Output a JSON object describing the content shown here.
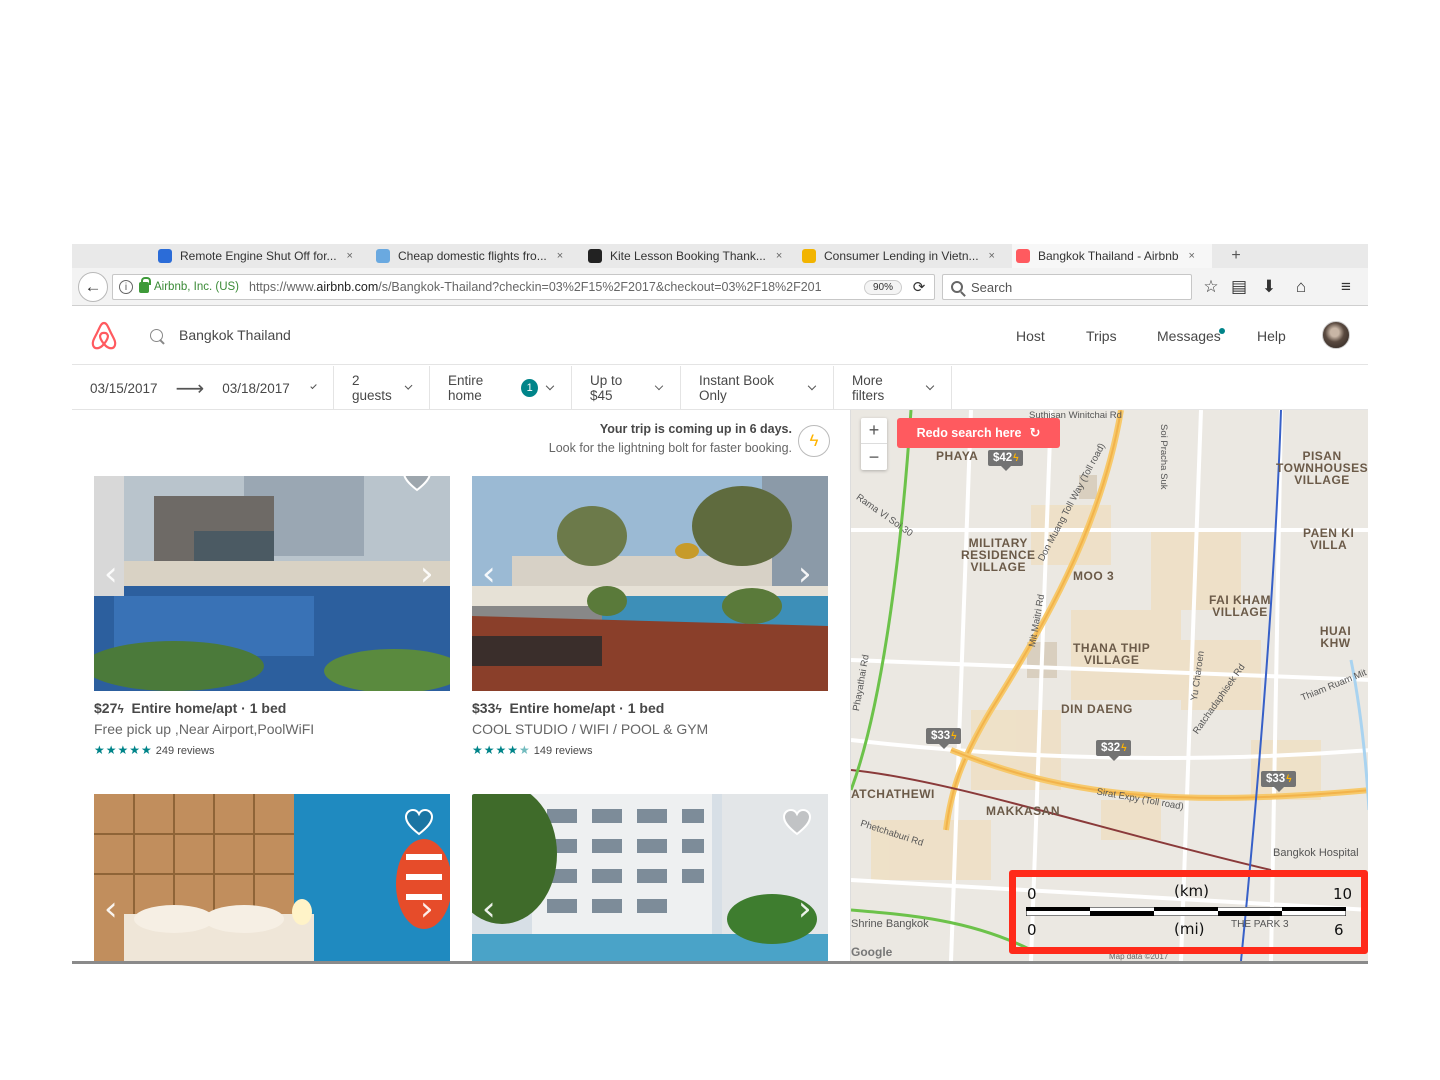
{
  "browser": {
    "tabs": [
      {
        "title": "Remote Engine Shut Off for...",
        "color": "#2b6cd8"
      },
      {
        "title": "Cheap domestic flights fro...",
        "color": "#6aa9e0"
      },
      {
        "title": "Kite Lesson Booking Thank...",
        "color": "#222222"
      },
      {
        "title": "Consumer Lending in Vietn...",
        "color": "#f2b400"
      },
      {
        "title": "Bangkok Thailand - Airbnb",
        "color": "#ff5a5f"
      }
    ],
    "tab_close": "×",
    "new_tab": "+",
    "site_identity": "Airbnb, Inc. (US)",
    "url_prefix": "https://www.",
    "url_host": "airbnb.com",
    "url_path": "/s/Bangkok-Thailand?checkin=03%2F15%2F2017&checkout=03%2F18%2F201",
    "zoom": "90%",
    "search_placeholder": "Search"
  },
  "header": {
    "search_value": "Bangkok Thailand",
    "nav": [
      "Host",
      "Trips",
      "Messages",
      "Help"
    ],
    "brand_color": "#ff5a5f"
  },
  "filters": {
    "checkin": "03/15/2017",
    "checkout": "03/18/2017",
    "guests": "2 guests",
    "room_type": "Entire home",
    "room_type_count": "1",
    "price": "Up to $45",
    "instant": "Instant Book Only",
    "more": "More filters"
  },
  "trip_notice": {
    "line1": "Your trip is coming up in 6 days.",
    "line2": "Look for the lightning bolt for faster booking."
  },
  "listings": [
    {
      "price": "$27",
      "title": "Entire home/apt · 1 bed",
      "subtitle": "Free pick up ,Near Airport,PoolWiFI",
      "rating": 5,
      "reviews": "249 reviews"
    },
    {
      "price": "$33",
      "title": "Entire home/apt · 1 bed",
      "subtitle": "COOL STUDIO / WIFI / POOL & GYM",
      "rating": 4.5,
      "reviews": "149 reviews"
    },
    {
      "price": "",
      "title": "",
      "subtitle": "",
      "rating": null,
      "reviews": ""
    },
    {
      "price": "",
      "title": "",
      "subtitle": "",
      "rating": null,
      "reviews": ""
    }
  ],
  "map": {
    "redo_label": "Redo search here",
    "zoom_in": "+",
    "zoom_out": "−",
    "pins": [
      "$42",
      "$33",
      "$32",
      "$33"
    ],
    "areas": [
      {
        "name": "MILITARY RESIDENCE VILLAGE",
        "lines": [
          "MILITARY",
          "RESIDENCE",
          "VILLAGE"
        ]
      },
      {
        "name": "MOO 3",
        "lines": [
          "MOO 3"
        ]
      },
      {
        "name": "THANA THIP VILLAGE",
        "lines": [
          "THANA THIP",
          "VILLAGE"
        ]
      },
      {
        "name": "DIN DAENG",
        "lines": [
          "DIN DAENG"
        ]
      },
      {
        "name": "FAI KHAM VILLAGE",
        "lines": [
          "FAI KHAM",
          "VILLAGE"
        ]
      },
      {
        "name": "PISAN TOWNHOUSES VILLAGE",
        "lines": [
          "PISAN",
          "TOWNHOUSES",
          "VILLAGE"
        ]
      },
      {
        "name": "PAEN KI VILLA",
        "lines": [
          "PAEN KI",
          "VILLA"
        ]
      },
      {
        "name": "HUAI KHW",
        "lines": [
          "HUAI KHW"
        ]
      },
      {
        "name": "MAKKASAN",
        "lines": [
          "MAKKASAN"
        ]
      },
      {
        "name": "ATCHATHEWI",
        "lines": [
          "ATCHATHEWI"
        ]
      },
      {
        "name": "PHAYA",
        "lines": [
          "PHAYA"
        ]
      }
    ],
    "roads": [
      "Don Muang Toll Way (Toll road)",
      "Sirat Expy (Toll road)",
      "Phetchaburi Rd",
      "Phayathai Rd",
      "Mit Maitri Rd",
      "Suthisan Winitchai Rd",
      "Soi Pracha Suk",
      "Rama VI Soi 30",
      "Thiam Ruam Mit",
      "Yu Charoen",
      "Ratchadaphisek Rd"
    ],
    "pois": [
      "Bangkok Hospital",
      "Shrine Bangkok",
      "THE PARK 3"
    ],
    "attribution": "Map data ©2017",
    "google": "Google",
    "scale": {
      "km_label": "(km)",
      "mi_label": "(mi)",
      "km_start": "0",
      "km_end": "10",
      "mi_start": "0",
      "mi_end": "6",
      "highlight_color": "#ff2a1a"
    }
  }
}
